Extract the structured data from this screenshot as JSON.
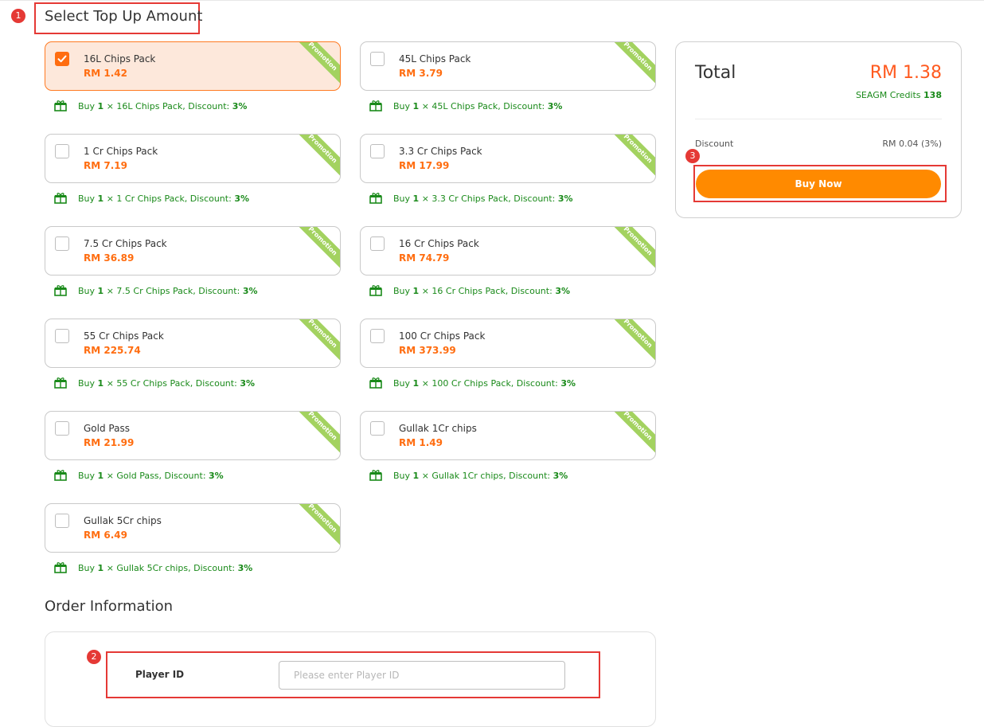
{
  "sections": {
    "top_up_title": "Select Top Up Amount",
    "order_info_title": "Order Information"
  },
  "markers": [
    "1",
    "2",
    "3"
  ],
  "promotion_label": "Promotion",
  "products": [
    {
      "name": "16L Chips Pack",
      "price": "RM 1.42",
      "selected": true,
      "promo": {
        "prefix": "Buy",
        "qty": "1",
        "text": "× 16L Chips Pack, Discount:",
        "discount": "3%"
      }
    },
    {
      "name": "45L Chips Pack",
      "price": "RM 3.79",
      "selected": false,
      "promo": {
        "prefix": "Buy",
        "qty": "1",
        "text": "× 45L Chips Pack, Discount:",
        "discount": "3%"
      }
    },
    {
      "name": "1 Cr Chips Pack",
      "price": "RM 7.19",
      "selected": false,
      "promo": {
        "prefix": "Buy",
        "qty": "1",
        "text": "× 1 Cr Chips Pack, Discount:",
        "discount": "3%"
      }
    },
    {
      "name": "3.3 Cr Chips Pack",
      "price": "RM 17.99",
      "selected": false,
      "promo": {
        "prefix": "Buy",
        "qty": "1",
        "text": "× 3.3 Cr Chips Pack, Discount:",
        "discount": "3%"
      }
    },
    {
      "name": "7.5 Cr Chips Pack",
      "price": "RM 36.89",
      "selected": false,
      "promo": {
        "prefix": "Buy",
        "qty": "1",
        "text": "× 7.5 Cr Chips Pack, Discount:",
        "discount": "3%"
      }
    },
    {
      "name": "16 Cr Chips Pack",
      "price": "RM 74.79",
      "selected": false,
      "promo": {
        "prefix": "Buy",
        "qty": "1",
        "text": "× 16 Cr Chips Pack, Discount:",
        "discount": "3%"
      }
    },
    {
      "name": "55 Cr Chips Pack",
      "price": "RM 225.74",
      "selected": false,
      "promo": {
        "prefix": "Buy",
        "qty": "1",
        "text": "× 55 Cr Chips Pack, Discount:",
        "discount": "3%"
      }
    },
    {
      "name": "100 Cr Chips Pack",
      "price": "RM 373.99",
      "selected": false,
      "promo": {
        "prefix": "Buy",
        "qty": "1",
        "text": "× 100 Cr Chips Pack, Discount:",
        "discount": "3%"
      }
    },
    {
      "name": "Gold Pass",
      "price": "RM 21.99",
      "selected": false,
      "promo": {
        "prefix": "Buy",
        "qty": "1",
        "text": "× Gold Pass, Discount:",
        "discount": "3%"
      }
    },
    {
      "name": "Gullak 1Cr chips",
      "price": "RM 1.49",
      "selected": false,
      "promo": {
        "prefix": "Buy",
        "qty": "1",
        "text": "× Gullak 1Cr chips, Discount:",
        "discount": "3%"
      }
    },
    {
      "name": "Gullak 5Cr chips",
      "price": "RM 6.49",
      "selected": false,
      "promo": {
        "prefix": "Buy",
        "qty": "1",
        "text": "× Gullak 5Cr chips, Discount:",
        "discount": "3%"
      }
    }
  ],
  "summary": {
    "total_label": "Total",
    "total_value": "RM 1.38",
    "credits_label": "SEAGM Credits",
    "credits_value": "138",
    "discount_label": "Discount",
    "discount_value": "RM 0.04 (3%)",
    "buy_button": "Buy Now"
  },
  "order": {
    "player_id_label": "Player ID",
    "player_id_value": "",
    "player_id_placeholder": "Please enter Player ID"
  },
  "colors": {
    "accent": "#ff6d10",
    "button": "#ff8a00",
    "promo_green": "#1a8a1a",
    "ribbon": "#a3d260",
    "annotation_red": "#e53935"
  }
}
